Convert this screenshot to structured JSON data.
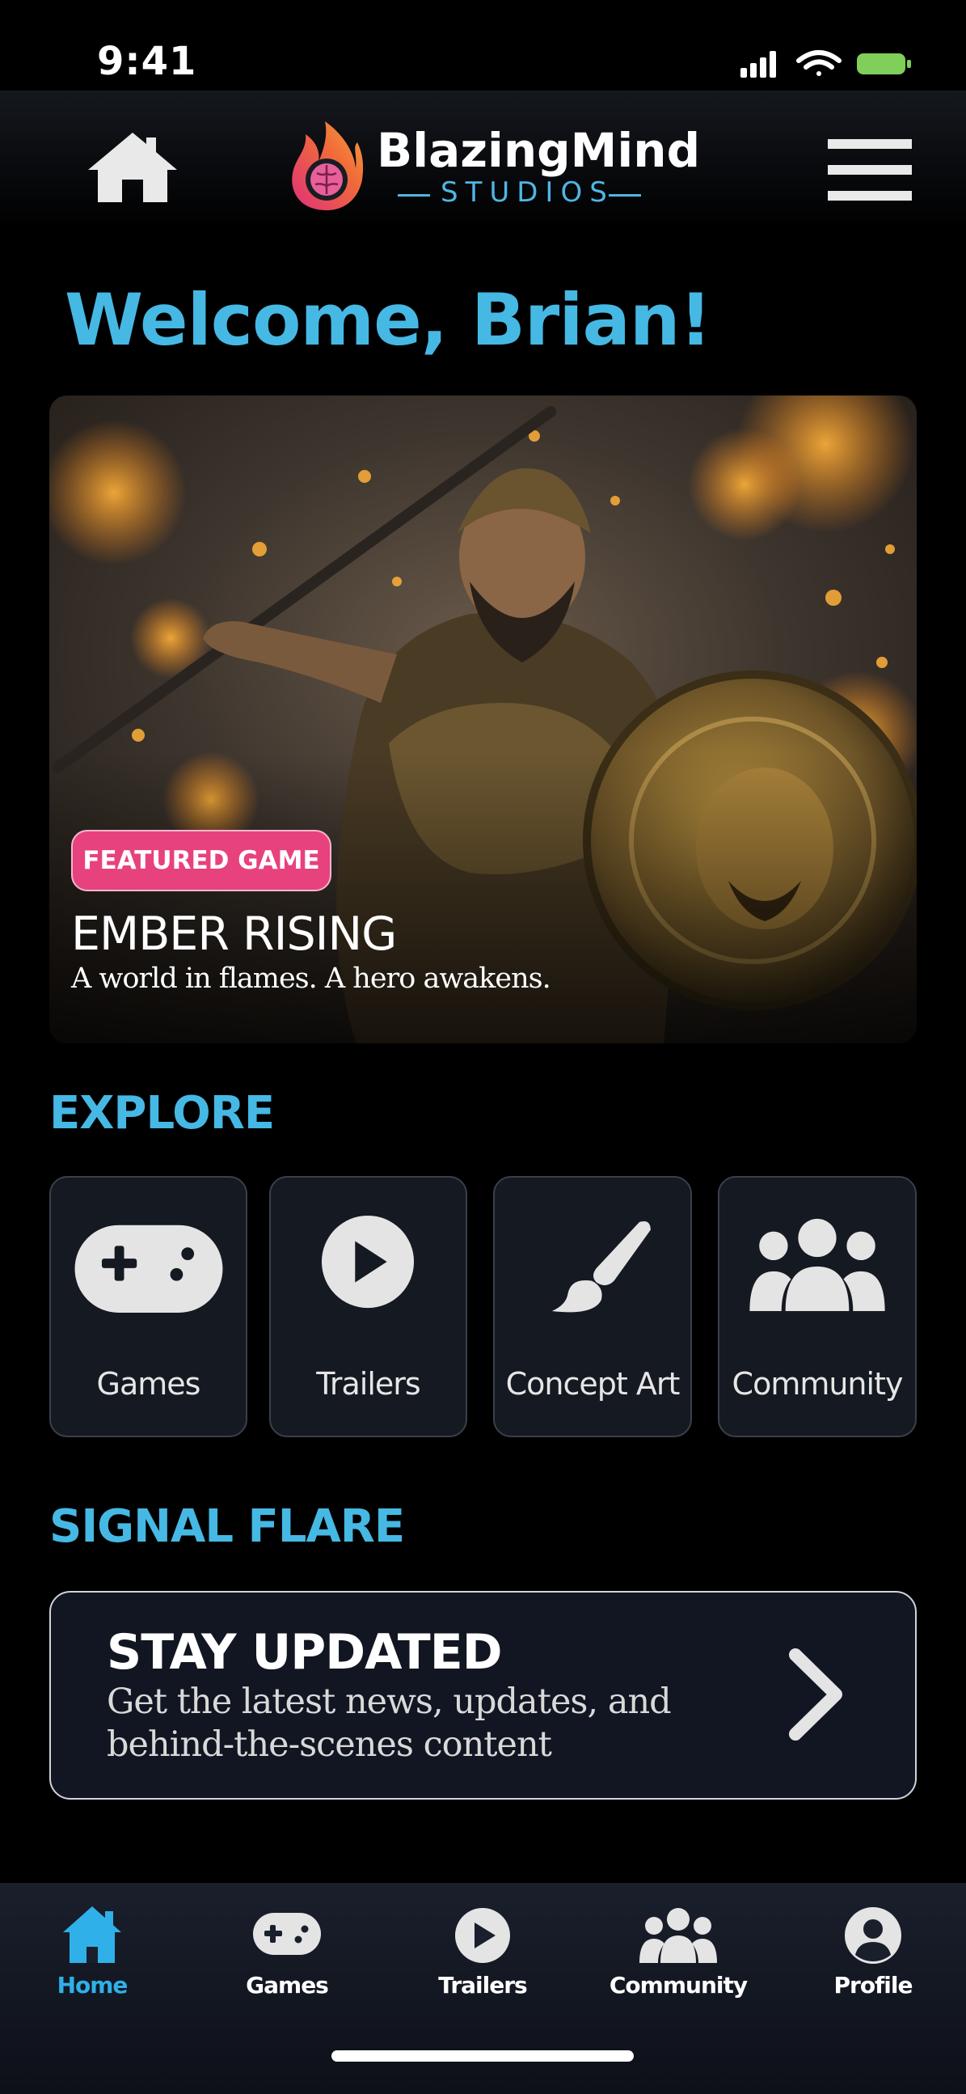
{
  "status_bar": {
    "time": "9:41"
  },
  "header": {
    "brand_name": "BlazingMind",
    "brand_sub": "STUDIOS",
    "icons": [
      "home-icon",
      "flame-brain-logo",
      "hamburger-menu-icon"
    ]
  },
  "welcome": "Welcome, Brian!",
  "hero": {
    "badge": "FEATURED GAME",
    "title": "EMBER RISING",
    "tagline": "A world in flames. A hero awakens."
  },
  "explore": {
    "title": "EXPLORE",
    "cards": [
      {
        "label": "Games",
        "icon": "gamepad-icon"
      },
      {
        "label": "Trailers",
        "icon": "play-circle-icon"
      },
      {
        "label": "Concept Art",
        "icon": "paintbrush-icon"
      },
      {
        "label": "Community",
        "icon": "users-icon"
      }
    ]
  },
  "signal_flare": {
    "title": "SIGNAL FLARE",
    "card_title": "STAY UPDATED",
    "card_text": "Get the latest news, updates, and behind-the-scenes content"
  },
  "tabbar": {
    "active": "Home",
    "tabs": [
      {
        "label": "Home",
        "icon": "home-icon"
      },
      {
        "label": "Games",
        "icon": "gamepad-icon"
      },
      {
        "label": "Trailers",
        "icon": "play-circle-icon"
      },
      {
        "label": "Community",
        "icon": "users-icon"
      },
      {
        "label": "Profile",
        "icon": "user-circle-icon"
      }
    ]
  },
  "colors": {
    "accent": "#46b8e4",
    "badge": "#e7427d",
    "card_bg": "#151922",
    "active_tab": "#2fb0e8"
  }
}
